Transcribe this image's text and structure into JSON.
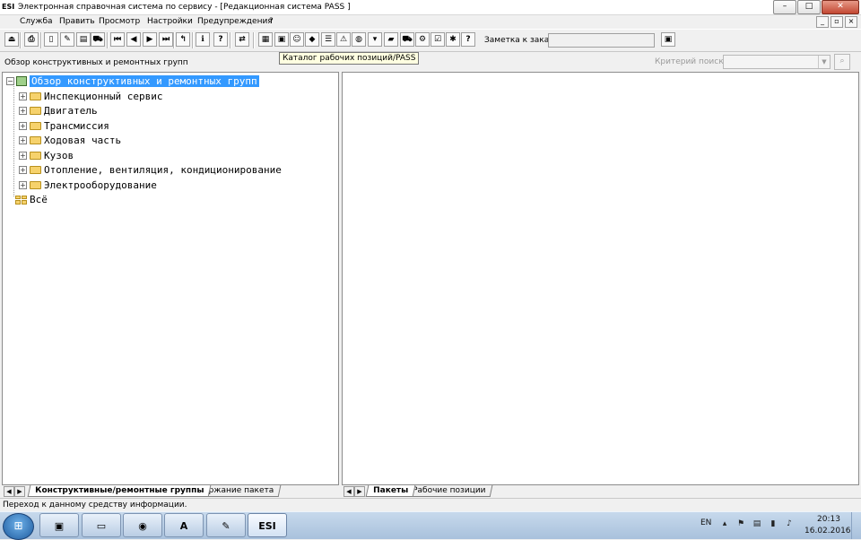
{
  "window": {
    "app_icon": "ESI",
    "title": "Электронная справочная система по сервису - [Редакционная система PASS ]",
    "buttons": {
      "minimize": "–",
      "maximize": "□",
      "close": "✕"
    }
  },
  "menu": {
    "items": [
      "Служба",
      "Править",
      "Просмотр",
      "Настройки",
      "Предупреждения",
      "?"
    ],
    "mdi": {
      "minimize": "_",
      "restore": "▫",
      "close": "×"
    }
  },
  "toolbar": {
    "icons": [
      {
        "name": "exit-icon",
        "glyph": "⏏"
      },
      {
        "name": "print-icon",
        "glyph": "⎙"
      },
      {
        "name": "new-doc-icon",
        "glyph": "▯"
      },
      {
        "name": "edit-doc-icon",
        "glyph": "✎"
      },
      {
        "name": "clipboard-icon",
        "glyph": "▤"
      },
      {
        "name": "car-icon",
        "glyph": "⛟"
      },
      {
        "name": "first-icon",
        "glyph": "⏮"
      },
      {
        "name": "prev-icon",
        "glyph": "◀"
      },
      {
        "name": "next-icon",
        "glyph": "▶"
      },
      {
        "name": "last-icon",
        "glyph": "⏭"
      },
      {
        "name": "up-level-icon",
        "glyph": "↰"
      },
      {
        "name": "info-icon",
        "glyph": "ℹ"
      },
      {
        "name": "help-icon",
        "glyph": "?"
      },
      {
        "name": "swap-icon",
        "glyph": "⇄"
      },
      {
        "name": "work-positions-catalog-icon",
        "glyph": "▦"
      },
      {
        "name": "grid-icon",
        "glyph": "▣"
      },
      {
        "name": "person-icon",
        "glyph": "☺"
      },
      {
        "name": "package-icon",
        "glyph": "◆"
      },
      {
        "name": "list-icon",
        "glyph": "☰"
      },
      {
        "name": "warning-icon",
        "glyph": "⚠"
      },
      {
        "name": "globe-icon",
        "glyph": "◍"
      },
      {
        "name": "basket-icon",
        "glyph": "▾"
      },
      {
        "name": "green-book-icon",
        "glyph": "▰"
      },
      {
        "name": "car-service-icon",
        "glyph": "⛟"
      },
      {
        "name": "mechanic-icon",
        "glyph": "⚙"
      },
      {
        "name": "checklist-icon",
        "glyph": "☑"
      },
      {
        "name": "settings-icon",
        "glyph": "✱"
      },
      {
        "name": "help-doc-icon",
        "glyph": "?"
      }
    ],
    "order_note_label": "Заметка к заказу:",
    "order_note_value": "",
    "order_note_button_glyph": "▣"
  },
  "subbar": {
    "panel_title": "Обзор конструктивных и ремонтных групп",
    "tooltip": "Каталог рабочих позиций/PASS",
    "search_label": "Критерий поиска:",
    "search_value": "",
    "search_arrow": "▼",
    "search_button_glyph": "⌕"
  },
  "tree": {
    "root": "Обзор конструктивных и ремонтных групп",
    "items": [
      "Инспекционный сервис",
      "Двигатель",
      "Трансмиссия",
      "Ходовая часть",
      "Кузов",
      "Отопление, вентиляция, кондиционирование",
      "Электрооборудование"
    ],
    "all": "Всё",
    "expand_glyph": "+",
    "collapse_glyph": "−"
  },
  "tabs_left": {
    "nav": [
      "◀",
      "▶"
    ],
    "tabs": [
      "Конструктивные/ремонтные группы",
      "Содержание пакета"
    ]
  },
  "tabs_right": {
    "nav": [
      "◀",
      "▶"
    ],
    "tabs": [
      "Пакеты",
      "Рабочие позиции"
    ]
  },
  "status": {
    "text": "Переход к данному средству информации."
  },
  "taskbar": {
    "start_glyph": "⊞",
    "apps": [
      {
        "name": "taskbar-app-archive",
        "glyph": "▣"
      },
      {
        "name": "taskbar-app-explorer",
        "glyph": "▭"
      },
      {
        "name": "taskbar-app-firefox",
        "glyph": "◉"
      },
      {
        "name": "taskbar-app-acrobat",
        "glyph": "A"
      },
      {
        "name": "taskbar-app-paint",
        "glyph": "✎"
      },
      {
        "name": "taskbar-app-esi",
        "glyph": "ESI"
      }
    ],
    "lang": "EN",
    "tray": [
      "▴",
      "⚑",
      "▤",
      "▮",
      "♪"
    ],
    "time": "20:13",
    "date": "16.02.2016"
  },
  "colors": {
    "selection": "#3399ff",
    "tooltip_bg": "#ffffe1"
  }
}
